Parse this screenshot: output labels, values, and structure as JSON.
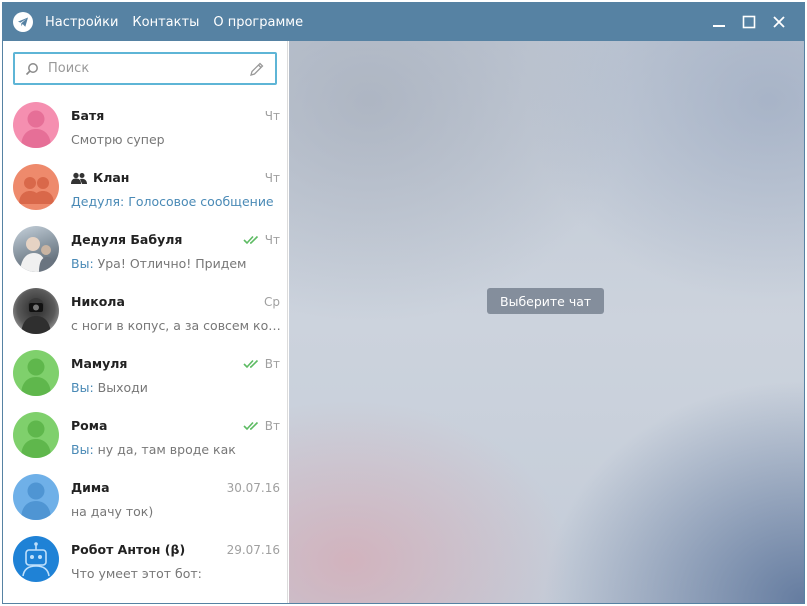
{
  "menu": {
    "items": [
      "Настройки",
      "Контакты",
      "О программе"
    ]
  },
  "search": {
    "placeholder": "Поиск"
  },
  "chats": [
    {
      "name": "Батя",
      "time": "Чт",
      "sender": "",
      "message": "Смотрю супер",
      "avatar_color": "#f58fb0",
      "avatar": "person-icon",
      "read": false,
      "group": false
    },
    {
      "name": "Клан",
      "time": "Чт",
      "sender": "Дедуля:",
      "message": " Голосовое сообщение",
      "avatar_color": "#ee8a6c",
      "avatar": "group-avatar-icon",
      "read": false,
      "group": true
    },
    {
      "name": "Дедуля Бабуля",
      "time": "Чт",
      "sender": "Вы:",
      "message": " Ура! Отлично! Придем",
      "avatar_color": "#8a9aa8",
      "avatar": "photo-avatar",
      "read": true,
      "group": false
    },
    {
      "name": "Никола",
      "time": "Ср",
      "sender": "",
      "message": "с ноги в копус, а за совсем коск …",
      "avatar_color": "#555555",
      "avatar": "photo-avatar",
      "read": false,
      "group": false
    },
    {
      "name": "Мамуля",
      "time": "Вт",
      "sender": "Вы:",
      "message": " Выходи",
      "avatar_color": "#7fd06c",
      "avatar": "person-icon",
      "read": true,
      "group": false
    },
    {
      "name": "Рома",
      "time": "Вт",
      "sender": "Вы:",
      "message": " ну да, там вроде как",
      "avatar_color": "#7fd06c",
      "avatar": "person-icon",
      "read": true,
      "group": false
    },
    {
      "name": "Дима",
      "time": "30.07.16",
      "sender": "",
      "message": "на дачу ток)",
      "avatar_color": "#6fb0e8",
      "avatar": "person-icon",
      "read": false,
      "group": false
    },
    {
      "name": "Робот Антон (β)",
      "time": "29.07.16",
      "sender": "",
      "message": "Что умеет этот бот:",
      "avatar_color": "#1f82d6",
      "avatar": "robot-avatar",
      "read": false,
      "group": false
    }
  ],
  "main": {
    "placeholder_label": "Выберите чат"
  },
  "colors": {
    "titlebar": "#5682a3",
    "accent": "#4a8ab6",
    "read_check": "#5dbb63"
  }
}
